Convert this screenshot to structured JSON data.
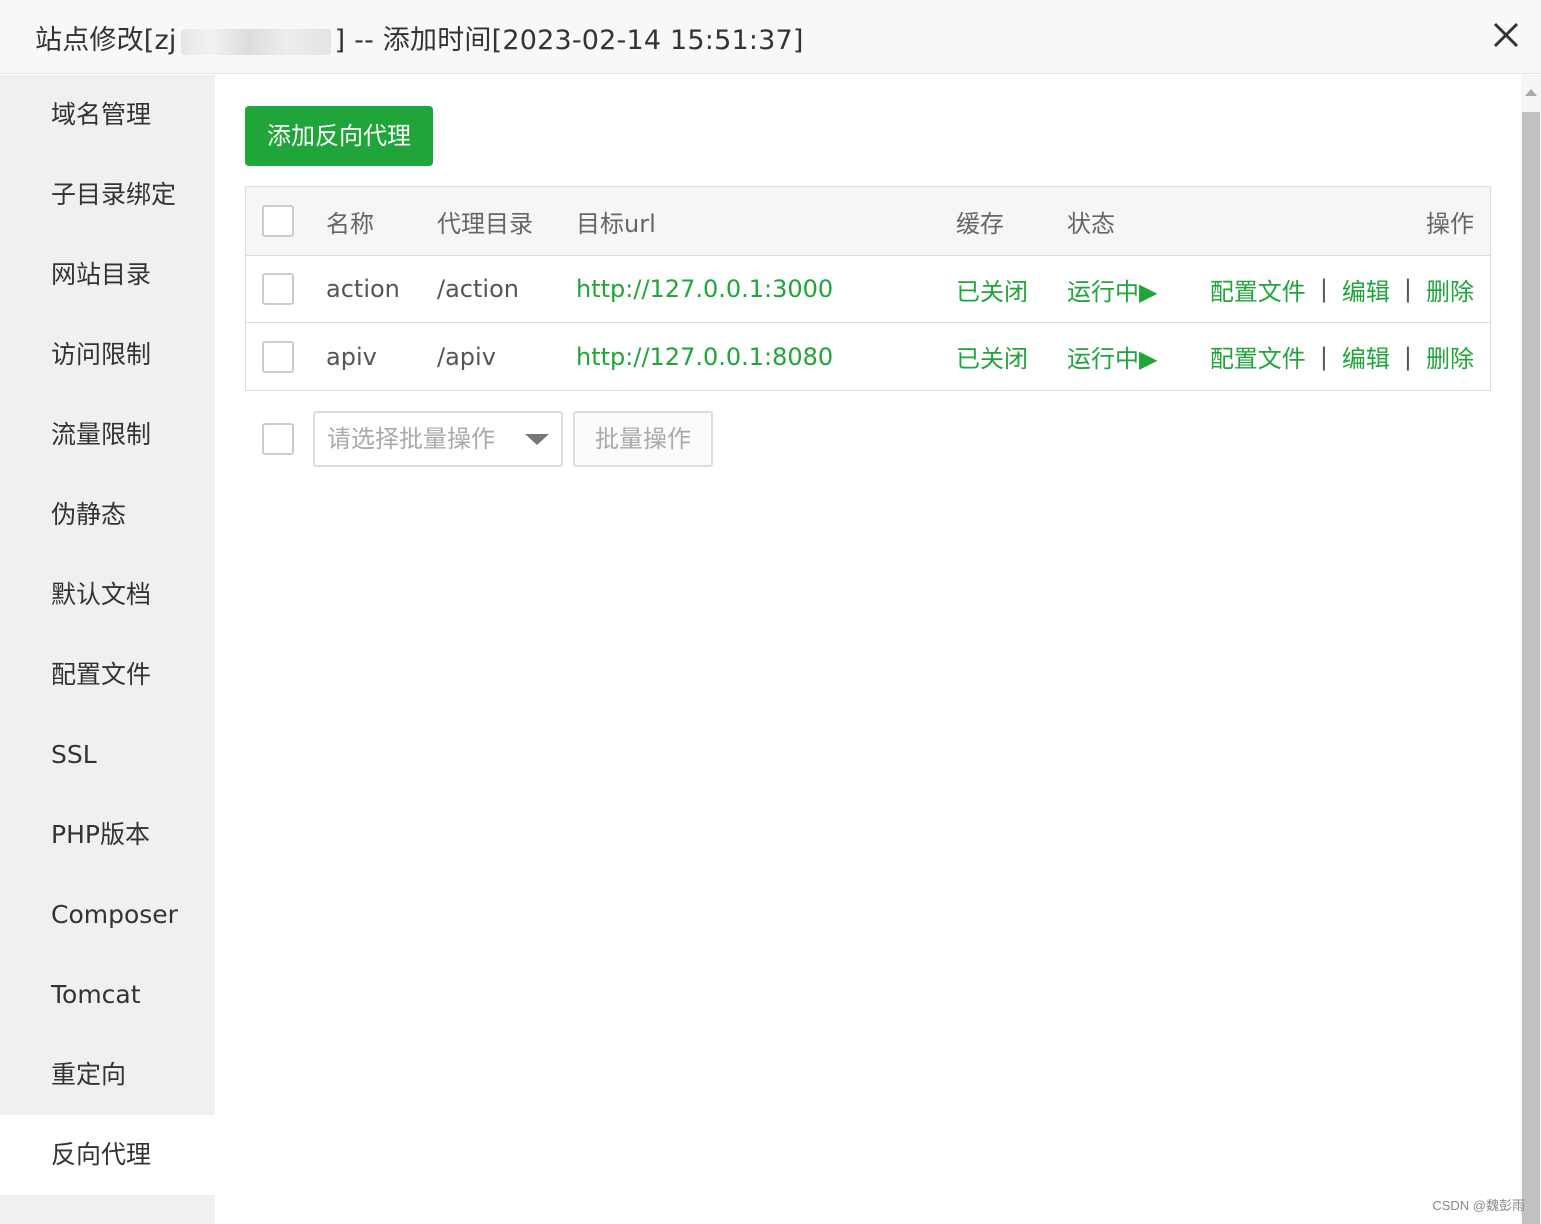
{
  "titlebar": {
    "title_prefix": "站点修改[zj",
    "title_suffix": "] -- 添加时间[2023-02-14 15:51:37]"
  },
  "sidebar": {
    "items": [
      {
        "label": "域名管理"
      },
      {
        "label": "子目录绑定"
      },
      {
        "label": "网站目录"
      },
      {
        "label": "访问限制"
      },
      {
        "label": "流量限制"
      },
      {
        "label": "伪静态"
      },
      {
        "label": "默认文档"
      },
      {
        "label": "配置文件"
      },
      {
        "label": "SSL"
      },
      {
        "label": "PHP版本"
      },
      {
        "label": "Composer"
      },
      {
        "label": "Tomcat"
      },
      {
        "label": "重定向"
      },
      {
        "label": "反向代理",
        "active": true
      }
    ]
  },
  "main": {
    "add_button": "添加反向代理",
    "table": {
      "headers": {
        "name": "名称",
        "dir": "代理目录",
        "url": "目标url",
        "cache": "缓存",
        "status": "状态",
        "ops": "操作"
      },
      "rows": [
        {
          "name": "action",
          "dir": "/action",
          "url": "http://127.0.0.1:3000",
          "cache": "已关闭",
          "status": "运行中▶",
          "op_config": "配置文件",
          "op_edit": "编辑",
          "op_delete": "删除"
        },
        {
          "name": "apiv",
          "dir": "/apiv",
          "url": "http://127.0.0.1:8080",
          "cache": "已关闭",
          "status": "运行中▶",
          "op_config": "配置文件",
          "op_edit": "编辑",
          "op_delete": "删除"
        }
      ],
      "separator": "|"
    },
    "batch": {
      "select_placeholder": "请选择批量操作",
      "button": "批量操作"
    }
  },
  "watermark": "CSDN @魏彭雨",
  "colors": {
    "accent": "#20a53a",
    "danger": "#ef3e36",
    "sidebar_bg": "#f0f0f0"
  },
  "icons": {
    "close": "close-icon",
    "dropdown": "chevron-down-icon",
    "scroll_up": "scroll-up-arrow-icon"
  }
}
